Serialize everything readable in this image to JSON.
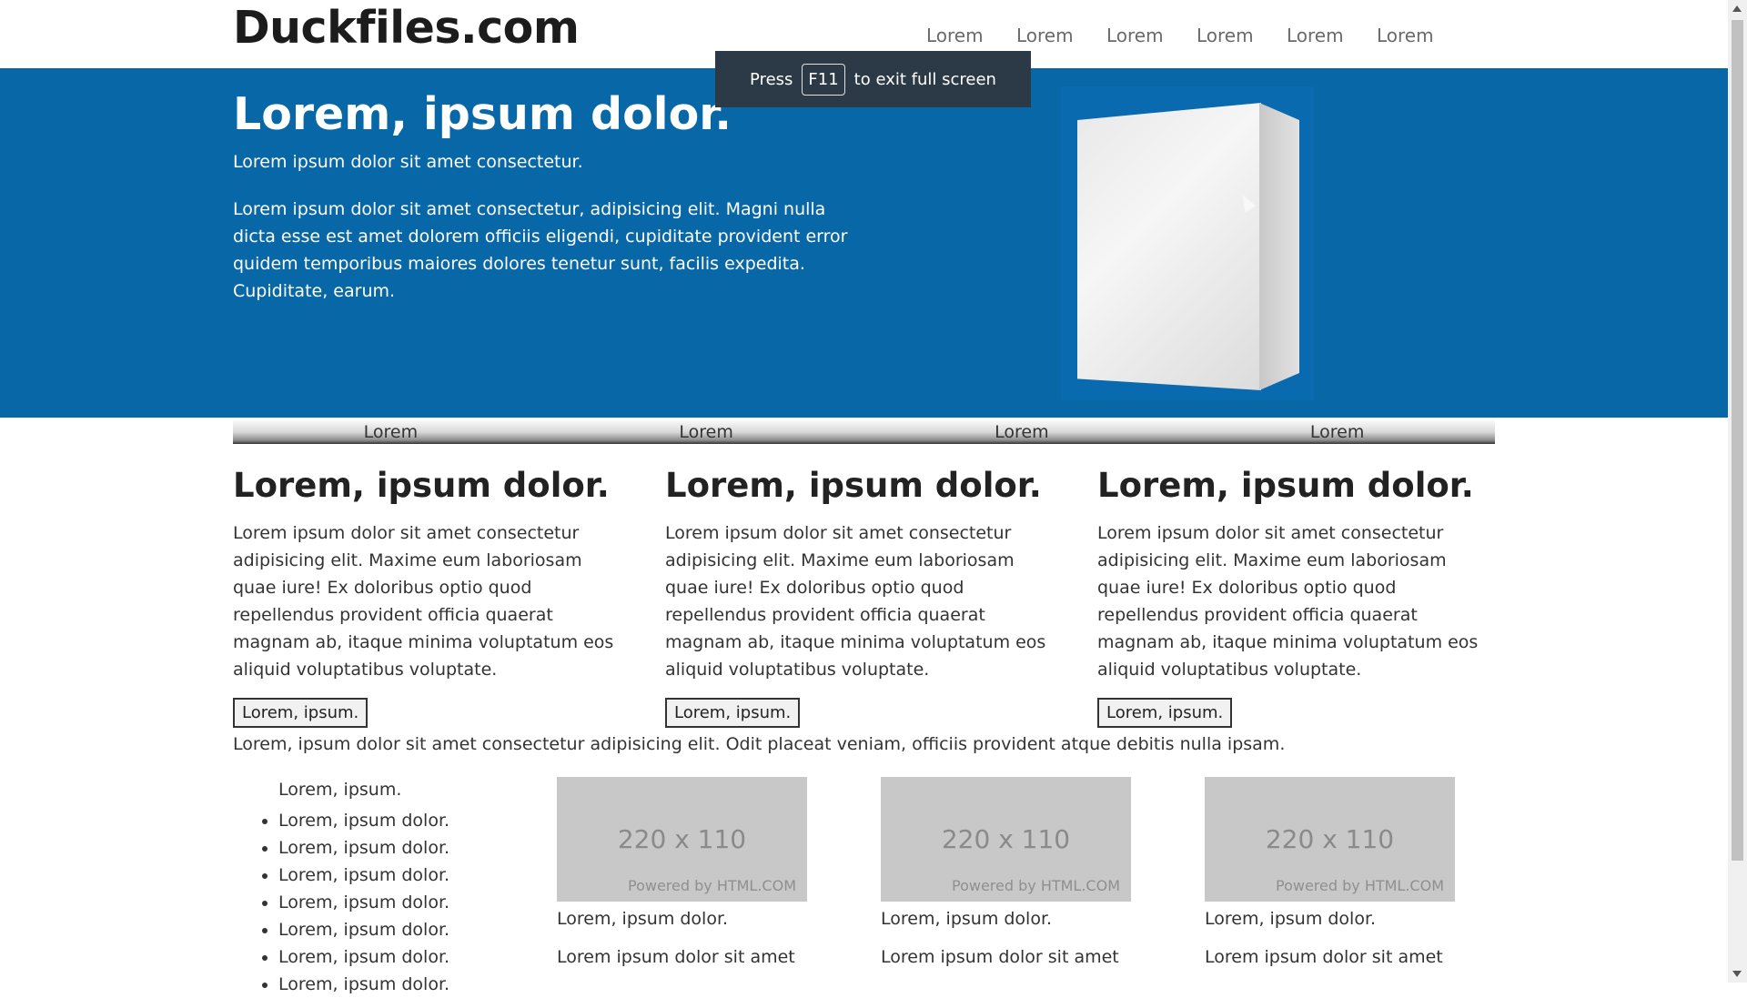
{
  "header": {
    "logo": "Duckfiles.com",
    "nav": [
      "Lorem",
      "Lorem",
      "Lorem",
      "Lorem",
      "Lorem",
      "Lorem"
    ]
  },
  "fullscreen_toast": {
    "press": "Press",
    "key": "F11",
    "rest": "to exit full screen"
  },
  "hero": {
    "title": "Lorem, ipsum dolor.",
    "subtitle": "Lorem ipsum dolor sit amet consectetur.",
    "text": "Lorem ipsum dolor sit amet consectetur, adipisicing elit. Magni nulla dicta esse est amet dolorem officiis eligendi, cupiditate provident error quidem temporibus maiores dolores tenetur sunt, facilis expedita. Cupiditate, earum."
  },
  "subnav": [
    "Lorem",
    "Lorem",
    "Lorem",
    "Lorem"
  ],
  "columns": [
    {
      "heading": "Lorem, ipsum dolor.",
      "text": "Lorem ipsum dolor sit amet consectetur adipisicing elit. Maxime eum laboriosam quae iure! Ex doloribus optio quod repellendus provident officia quaerat magnam ab, itaque minima voluptatum eos aliquid voluptatibus voluptate.",
      "button": "Lorem, ipsum."
    },
    {
      "heading": "Lorem, ipsum dolor.",
      "text": "Lorem ipsum dolor sit amet consectetur adipisicing elit. Maxime eum laboriosam quae iure! Ex doloribus optio quod repellendus provident officia quaerat magnam ab, itaque minima voluptatum eos aliquid voluptatibus voluptate.",
      "button": "Lorem, ipsum."
    },
    {
      "heading": "Lorem, ipsum dolor.",
      "text": "Lorem ipsum dolor sit amet consectetur adipisicing elit. Maxime eum laboriosam quae iure! Ex doloribus optio quod repellendus provident officia quaerat magnam ab, itaque minima voluptatum eos aliquid voluptatibus voluptate.",
      "button": "Lorem, ipsum."
    }
  ],
  "wide_line": "Lorem, ipsum dolor sit amet consectetur adipisicing elit. Odit placeat veniam, officiis provident atque debitis nulla ipsam.",
  "list": {
    "heading": "Lorem, ipsum.",
    "items": [
      "Lorem, ipsum dolor.",
      "Lorem, ipsum dolor.",
      "Lorem, ipsum dolor.",
      "Lorem, ipsum dolor.",
      "Lorem, ipsum dolor.",
      "Lorem, ipsum dolor.",
      "Lorem, ipsum dolor."
    ]
  },
  "cards": [
    {
      "size": "220 x 110",
      "powered": "Powered by HTML.COM",
      "caption": "Lorem, ipsum dolor.",
      "text": "Lorem ipsum dolor sit amet"
    },
    {
      "size": "220 x 110",
      "powered": "Powered by HTML.COM",
      "caption": "Lorem, ipsum dolor.",
      "text": "Lorem ipsum dolor sit amet"
    },
    {
      "size": "220 x 110",
      "powered": "Powered by HTML.COM",
      "caption": "Lorem, ipsum dolor.",
      "text": "Lorem ipsum dolor sit amet"
    }
  ],
  "colors": {
    "hero_bg": "#0867a6",
    "toast_bg": "#2c3a47"
  }
}
